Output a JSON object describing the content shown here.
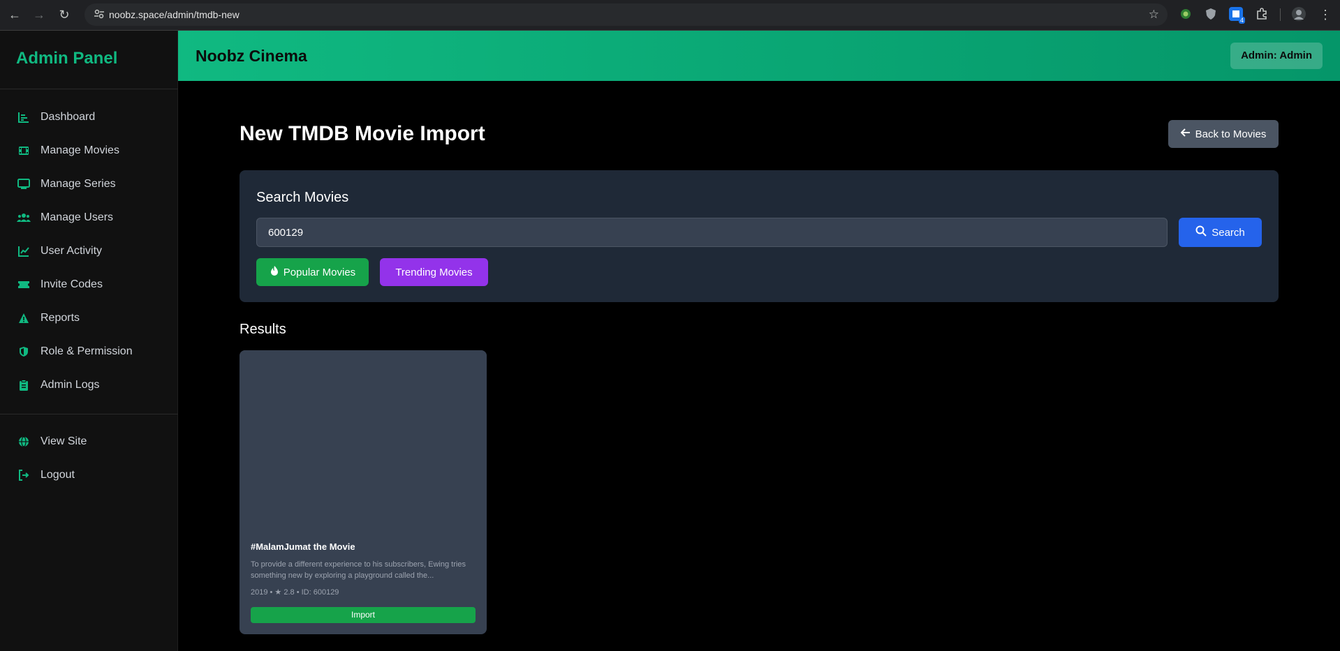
{
  "browser": {
    "url": "noobz.space/admin/tmdb-new",
    "extension_badge": "4"
  },
  "sidebar": {
    "brand": "Admin Panel",
    "items": [
      {
        "label": "Dashboard",
        "icon": "chart-bar-icon"
      },
      {
        "label": "Manage Movies",
        "icon": "film-icon"
      },
      {
        "label": "Manage Series",
        "icon": "tv-icon"
      },
      {
        "label": "Manage Users",
        "icon": "users-icon"
      },
      {
        "label": "User Activity",
        "icon": "chart-line-icon"
      },
      {
        "label": "Invite Codes",
        "icon": "ticket-icon"
      },
      {
        "label": "Reports",
        "icon": "warning-icon"
      },
      {
        "label": "Role & Permission",
        "icon": "shield-icon"
      },
      {
        "label": "Admin Logs",
        "icon": "clipboard-icon"
      }
    ],
    "footer_items": [
      {
        "label": "View Site",
        "icon": "globe-icon"
      },
      {
        "label": "Logout",
        "icon": "logout-icon"
      }
    ]
  },
  "header": {
    "title": "Noobz Cinema",
    "admin_badge": "Admin: Admin"
  },
  "main": {
    "page_title": "New TMDB Movie Import",
    "back_button": "Back to Movies",
    "search": {
      "title": "Search Movies",
      "value": "600129",
      "button": "Search",
      "popular_button": "Popular Movies",
      "trending_button": "Trending Movies"
    },
    "results_title": "Results",
    "results": [
      {
        "title": "#MalamJumat the Movie",
        "description": "To provide a different experience to his subscribers, Ewing tries something new by exploring a playground called the...",
        "meta": "2019 • ★ 2.8 • ID: 600129",
        "button": "Import"
      }
    ]
  },
  "colors": {
    "accent": "#10b981",
    "sidebar_bg": "#111111",
    "panel_bg": "#1f2937",
    "card_bg": "#374151",
    "search_button": "#2563eb",
    "popular_button": "#16a34a",
    "trending_button": "#9333ea",
    "back_button": "#4b5563"
  }
}
